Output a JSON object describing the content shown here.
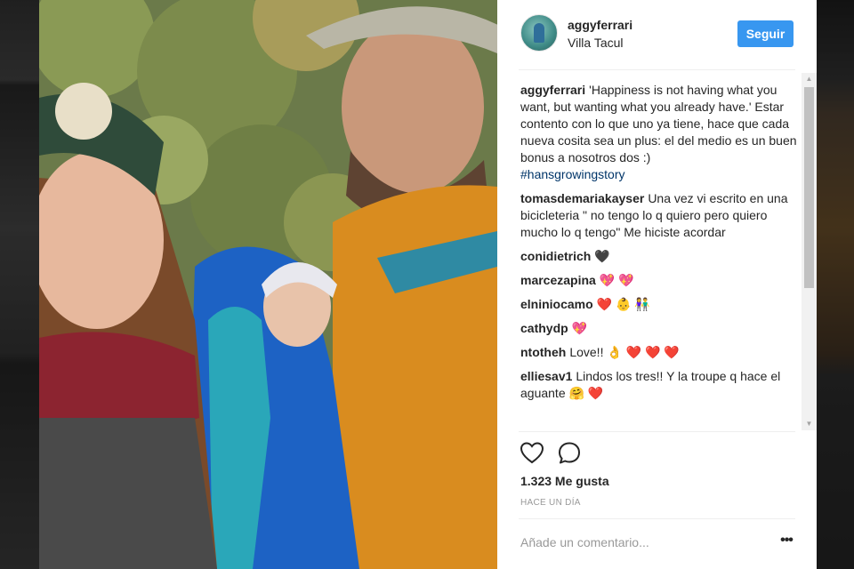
{
  "post": {
    "username": "aggyferrari",
    "location": "Villa Tacul",
    "follow_label": "Seguir",
    "caption_user": "aggyferrari",
    "caption_text": "'Happiness is not having what you want, but wanting what you already have.' Estar contento con lo que uno ya tiene, hace que cada nueva cosita sea un plus: el del medio es un buen bonus a nosotros dos :)",
    "hashtag": "#hansgrowingstory"
  },
  "comments": [
    {
      "user": "tomasdemariakayser",
      "text": "Una vez vi escrito en una bicicleteria \" no tengo lo q quiero pero quiero mucho lo q tengo\" Me hiciste acordar"
    },
    {
      "user": "conidietrich",
      "text": "🖤"
    },
    {
      "user": "marcezapina",
      "text": "💖 💖"
    },
    {
      "user": "elniniocamo",
      "text": "❤️ 👶 👫"
    },
    {
      "user": "cathydp",
      "text": "💖"
    },
    {
      "user": "ntotheh",
      "text": "Love!! 👌 ❤️ ❤️ ❤️"
    },
    {
      "user": "elliesav1",
      "text": "Lindos los tres!! Y la troupe q hace el aguante 🤗 ❤️"
    }
  ],
  "actions": {
    "like_icon": "heart-outline-icon",
    "comment_icon": "speech-bubble-icon",
    "likes": "1.323 Me gusta",
    "time": "HACE UN DÍA"
  },
  "composer": {
    "placeholder": "Añade un comentario...",
    "more_label": "•••"
  },
  "colors": {
    "follow_button": "#3897f0",
    "hashtag": "#003569",
    "text": "#262626",
    "muted": "#999999"
  }
}
